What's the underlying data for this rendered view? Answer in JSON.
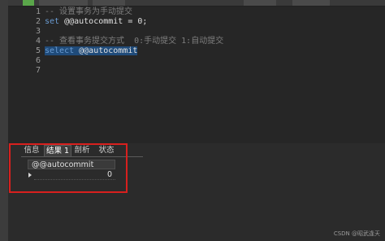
{
  "editor": {
    "line_numbers": [
      "1",
      "2",
      "3",
      "4",
      "5",
      "6",
      "7"
    ],
    "lines": [
      {
        "text": "-- 设置事务为手动提交",
        "kind": "comment"
      },
      {
        "kw": "set",
        "rest": " @@autocommit = 0;"
      },
      {
        "text": "",
        "kind": "plain"
      },
      {
        "text": "-- 查看事务提交方式  0:手动提交 1:自动提交",
        "kind": "comment"
      },
      {
        "kw": "select",
        "rest": " @@autocommit",
        "selected": true
      },
      {
        "text": "",
        "kind": "plain"
      },
      {
        "text": "",
        "kind": "plain"
      }
    ]
  },
  "result_panel": {
    "tabs": [
      {
        "label": "信息",
        "active": false
      },
      {
        "label": "结果 1",
        "active": true
      },
      {
        "label": "剖析",
        "active": false
      },
      {
        "label": "状态",
        "active": false
      }
    ],
    "grid": {
      "columns": [
        "@@autocommit"
      ],
      "rows": [
        [
          "0"
        ]
      ]
    }
  },
  "watermark": "CSDN @昭武逢天",
  "colors": {
    "highlight_box": "#d8201e",
    "keyword": "#6a9bd1",
    "comment": "#7e7e7e",
    "selection": "#1f4b7a"
  }
}
